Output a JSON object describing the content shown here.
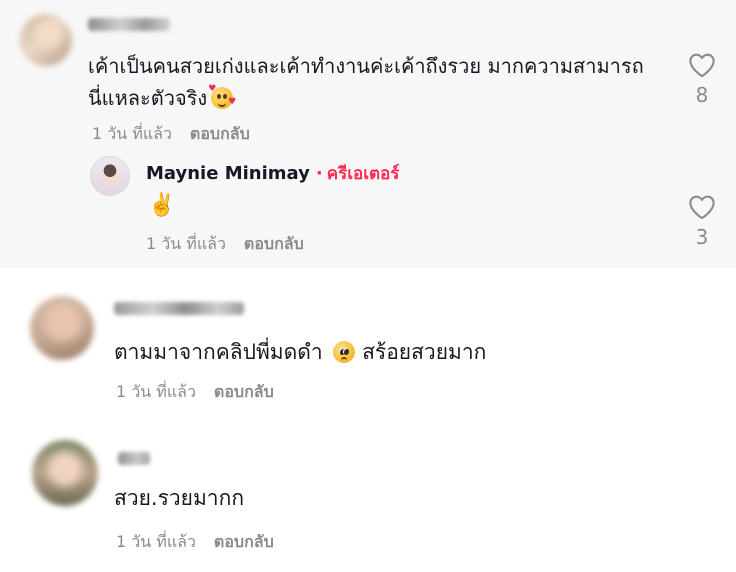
{
  "comments": [
    {
      "text": "เค้าเป็นคนสวยเก่งและเค้าทำงานค่ะเค้าถึงรวย มากความสามารถนี่แหละตัวจริง",
      "emoji": "smiling-face-with-hearts",
      "time": "1 วัน ที่แล้ว",
      "reply_label": "ตอบกลับ",
      "likes": "8",
      "reply": {
        "author": "Maynie Minimay",
        "separator": "·",
        "badge": "ครีเอเตอร์",
        "text": "✌️",
        "time": "1 วัน ที่แล้ว",
        "reply_label": "ตอบกลับ",
        "likes": "3"
      }
    },
    {
      "text_before": "ตามมาจากคลิปพี่มดดำ",
      "emoji": "pleading-face",
      "text_after": "สร้อยสวยมาก",
      "time": "1 วัน ที่แล้ว",
      "reply_label": "ตอบกลับ"
    },
    {
      "text": "สวย.รวยมากก",
      "time": "1 วัน ที่แล้ว",
      "reply_label": "ตอบกลับ"
    }
  ],
  "colors": {
    "accent": "#fe2c55",
    "muted": "#8a8b91",
    "text": "#161823",
    "highlight_band": "#f7f7f7"
  },
  "icons": {
    "like": "heart-outline-icon"
  }
}
